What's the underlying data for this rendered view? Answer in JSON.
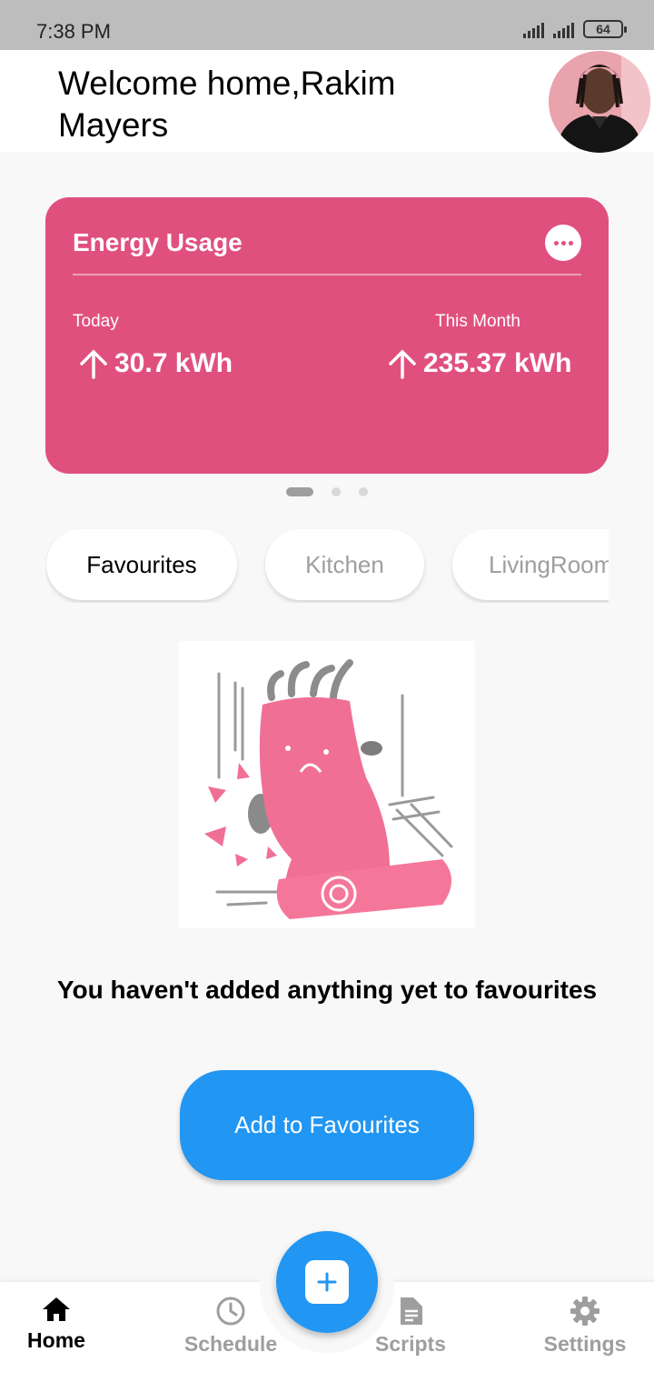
{
  "status_bar": {
    "time": "7:38 PM",
    "battery": "64"
  },
  "header": {
    "greeting": "Welcome home,Rakim Mayers"
  },
  "energy_card": {
    "title": "Energy Usage",
    "today_label": "Today",
    "today_value": "30.7 kWh",
    "month_label": "This Month",
    "month_value": "235.37 kWh",
    "color": "#e0507e"
  },
  "carousel": {
    "pages": 3,
    "active": 0
  },
  "tabs": [
    {
      "label": "Favourites",
      "active": true
    },
    {
      "label": "Kitchen",
      "active": false
    },
    {
      "label": "LivingRoom",
      "active": false
    }
  ],
  "empty_state": {
    "message": "You haven't added anything yet to favourites",
    "button": "Add to Favourites"
  },
  "bottom_nav": {
    "items": [
      {
        "label": "Home",
        "icon": "home-icon",
        "active": true
      },
      {
        "label": "Schedule",
        "icon": "clock-icon",
        "active": false
      },
      {
        "label": "Scripts",
        "icon": "document-icon",
        "active": false
      },
      {
        "label": "Settings",
        "icon": "gear-icon",
        "active": false
      }
    ],
    "fab_icon": "plus-icon",
    "accent": "#2196f3"
  }
}
